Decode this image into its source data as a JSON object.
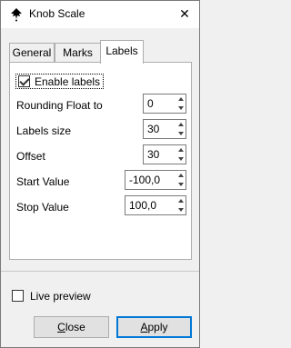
{
  "window": {
    "title": "Knob Scale",
    "close_glyph": "✕",
    "icon": "inkscape-logo-icon"
  },
  "tabs": [
    {
      "label": "General",
      "selected": false
    },
    {
      "label": "Marks",
      "selected": false
    },
    {
      "label": "Labels",
      "selected": true
    }
  ],
  "labels_tab": {
    "enable_labels": {
      "label": "Enable labels",
      "checked": true
    },
    "fields": [
      {
        "label": "Rounding Float to",
        "value": "0"
      },
      {
        "label": "Labels size",
        "value": "30"
      },
      {
        "label": "Offset",
        "value": "30"
      },
      {
        "label": "Start Value",
        "value": "-100,0"
      },
      {
        "label": "Stop Value",
        "value": "100,0"
      }
    ]
  },
  "live_preview": {
    "label": "Live preview",
    "checked": false
  },
  "buttons": {
    "close": {
      "first": "C",
      "rest": "lose"
    },
    "apply": {
      "first": "A",
      "rest": "pply"
    }
  },
  "colors": {
    "accent": "#0078d7",
    "window_bg": "#f0f0f0",
    "panel_bg": "#ffffff"
  }
}
